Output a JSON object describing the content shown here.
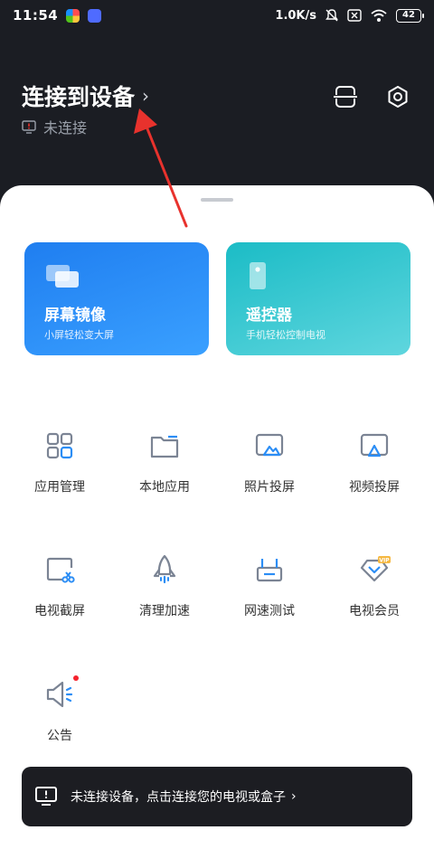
{
  "status_bar": {
    "time": "11:54",
    "network_speed": "1.0K/s",
    "battery": "42",
    "icons": [
      "app-icon-1",
      "app-icon-2",
      "mute-icon",
      "sim-icon",
      "wifi-icon",
      "battery-icon"
    ]
  },
  "header": {
    "title": "连接到设备",
    "status": "未连接",
    "icons": [
      "scan-icon",
      "settings-icon"
    ]
  },
  "cards": [
    {
      "title": "屏幕镜像",
      "subtitle": "小屏轻松变大屏",
      "color": "#2b8df5",
      "icon": "mirror-icon"
    },
    {
      "title": "遥控器",
      "subtitle": "手机轻松控制电视",
      "color": "#32c6cf",
      "icon": "remote-icon"
    }
  ],
  "grid": [
    {
      "label": "应用管理",
      "icon": "app-management-icon"
    },
    {
      "label": "本地应用",
      "icon": "folder-icon"
    },
    {
      "label": "照片投屏",
      "icon": "photo-cast-icon"
    },
    {
      "label": "视频投屏",
      "icon": "video-cast-icon"
    },
    {
      "label": "电视截屏",
      "icon": "screenshot-icon"
    },
    {
      "label": "清理加速",
      "icon": "rocket-icon"
    },
    {
      "label": "网速测试",
      "icon": "router-icon"
    },
    {
      "label": "电视会员",
      "icon": "vip-icon"
    },
    {
      "label": "公告",
      "icon": "announcement-icon",
      "badge": true
    }
  ],
  "banner": {
    "text": "未连接设备，点击连接您的电视或盒子",
    "icon": "tv-icon"
  },
  "colors": {
    "header_bg": "#1b1d23",
    "icon_gray": "#7b8494",
    "icon_blue": "#2b8df5",
    "badge_red": "#f5222d",
    "annotation_red": "#e8322d"
  }
}
